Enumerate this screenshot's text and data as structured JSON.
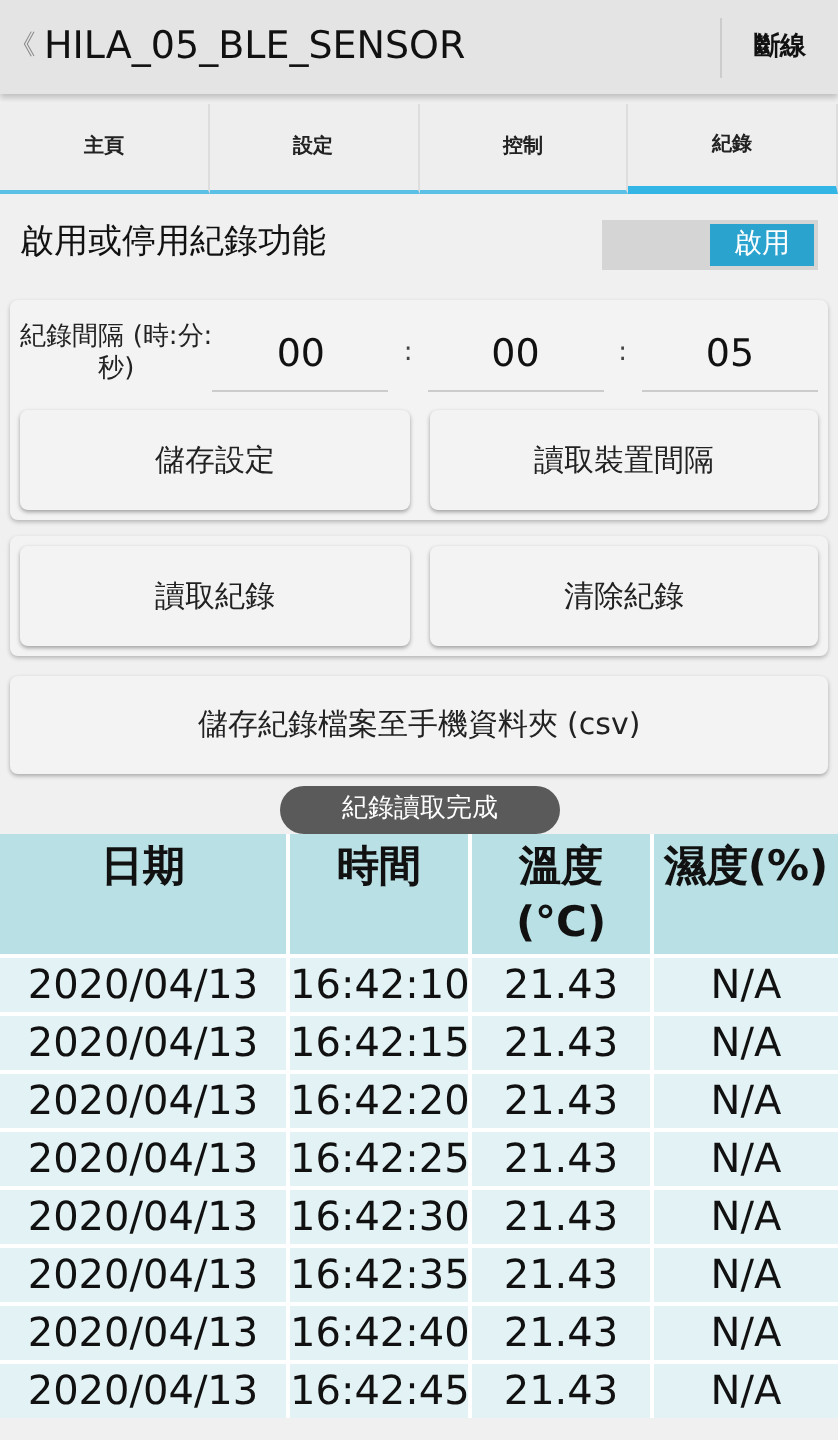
{
  "app_bar": {
    "back": "《",
    "title": "HILA_05_BLE_SENSOR",
    "action": "斷線"
  },
  "tabs": [
    {
      "label": "主頁",
      "selected": false
    },
    {
      "label": "設定",
      "selected": false
    },
    {
      "label": "控制",
      "selected": false
    },
    {
      "label": "紀錄",
      "selected": true
    }
  ],
  "logging": {
    "label": "啟用或停用紀錄功能",
    "switch_text": "啟用",
    "on": true
  },
  "interval": {
    "label": "紀錄間隔 (時:分:秒)",
    "fields": [
      {
        "value": "00"
      },
      {
        "value": "00"
      },
      {
        "value": "05"
      }
    ],
    "separators": [
      ":",
      ":"
    ]
  },
  "interval_buttons": [
    "儲存設定",
    "讀取裝置間隔"
  ],
  "record_buttons": [
    "讀取紀錄",
    "清除紀錄"
  ],
  "export_button": "儲存紀錄檔案至手機資料夾 (csv)",
  "table": {
    "columns": [
      "日期",
      "時間",
      "溫度 (°C)",
      "濕度(%)"
    ],
    "rows": [
      [
        "2020/04/13",
        "16:42:10",
        "21.43",
        "N/A"
      ],
      [
        "2020/04/13",
        "16:42:15",
        "21.43",
        "N/A"
      ],
      [
        "2020/04/13",
        "16:42:20",
        "21.43",
        "N/A"
      ],
      [
        "2020/04/13",
        "16:42:25",
        "21.43",
        "N/A"
      ],
      [
        "2020/04/13",
        "16:42:30",
        "21.43",
        "N/A"
      ],
      [
        "2020/04/13",
        "16:42:35",
        "21.43",
        "N/A"
      ],
      [
        "2020/04/13",
        "16:42:40",
        "21.43",
        "N/A"
      ],
      [
        "2020/04/13",
        "16:42:45",
        "21.43",
        "N/A"
      ]
    ]
  },
  "toast": "紀錄讀取完成"
}
